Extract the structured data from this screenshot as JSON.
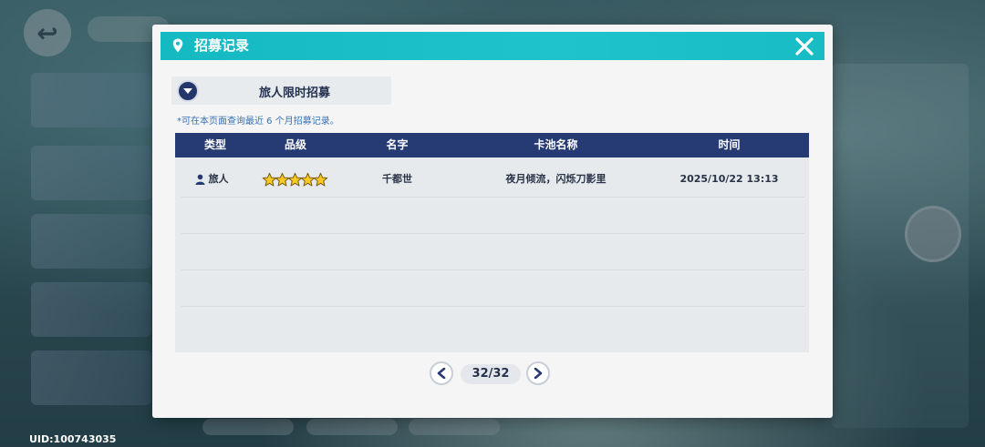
{
  "background": {
    "uid_text": "UID:100743035"
  },
  "modal": {
    "title": "招募记录",
    "pin_icon": "map-pin-icon",
    "close_icon": "close-icon",
    "header_color": "#14b9c2"
  },
  "banner_select": {
    "label": "旅人限时招募",
    "icon": "chevron-down-icon"
  },
  "hint": "*可在本页面查询最近 6 个月招募记录。",
  "table": {
    "header_color": "#263a73",
    "columns": [
      "类型",
      "品级",
      "名字",
      "卡池名称",
      "时间"
    ],
    "rows": [
      {
        "type": "旅人",
        "type_icon": "person-icon",
        "rarity_stars": 5,
        "name": "千都世",
        "pool": "夜月倾流，闪烁刀影里",
        "time": "2025/10/22 13:13"
      }
    ]
  },
  "pagination": {
    "current": "32/32",
    "prev_icon": "chevron-left-icon",
    "next_icon": "chevron-right-icon"
  }
}
